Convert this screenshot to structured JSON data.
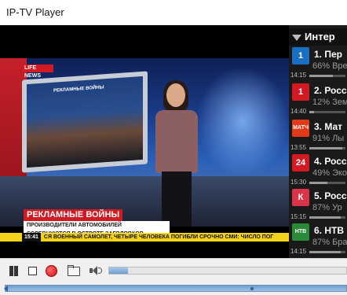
{
  "window": {
    "title": "IP-TV Player"
  },
  "video": {
    "station_logo": "LIFE NEWS",
    "monitor_title": "РЕКЛАМНЫЕ ВОЙНЫ",
    "headline": "РЕКЛАМНЫЕ ВОЙНЫ",
    "subline": "ПРОИЗВОДИТЕЛИ АВТОМОБИЛЕЙ СОРЕВНУЮТСЯ В ОСТРОТЕ ЗАГОЛОВКОВ",
    "ticker_time": "15:41",
    "ticker_text": "СЯ ВОЕННЫЙ САМОЛЕТ, ЧЕТЫРЕ ЧЕЛОВЕКА ПОГИБЛИ   СРОЧНО   СМИ: ЧИСЛО ПОГ"
  },
  "channel_list": {
    "header": "Интер",
    "channels": [
      {
        "logo_text": "1",
        "name": "1. Пер",
        "info": "66% Вре",
        "time": "14:15",
        "progress": 0.66,
        "logo_color": "#1b6fc2"
      },
      {
        "logo_text": "1",
        "name": "2. Росс",
        "info": "12% Зем",
        "time": "14:40",
        "progress": 0.12,
        "logo_color": "#d11a22"
      },
      {
        "logo_text": "МАТЧ",
        "name": "3. Мат",
        "info": "91% Лы",
        "time": "13:55",
        "progress": 0.91,
        "logo_color": "#e03a1a"
      },
      {
        "logo_text": "24",
        "name": "4. Росс",
        "info": "49% Эко",
        "time": "15:30",
        "progress": 0.49,
        "logo_color": "#d11a22"
      },
      {
        "logo_text": "К",
        "name": "5. Росс",
        "info": "87% Ур",
        "time": "15:15",
        "progress": 0.87,
        "logo_color": "#d9344a"
      },
      {
        "logo_text": "НТВ",
        "name": "6. НТВ",
        "info": "87% Бра",
        "time": "14:15",
        "progress": 0.87,
        "logo_color": "#2a8a3a"
      }
    ]
  },
  "controls": {
    "volume_level": 0.08,
    "seek_position": 0.72
  }
}
